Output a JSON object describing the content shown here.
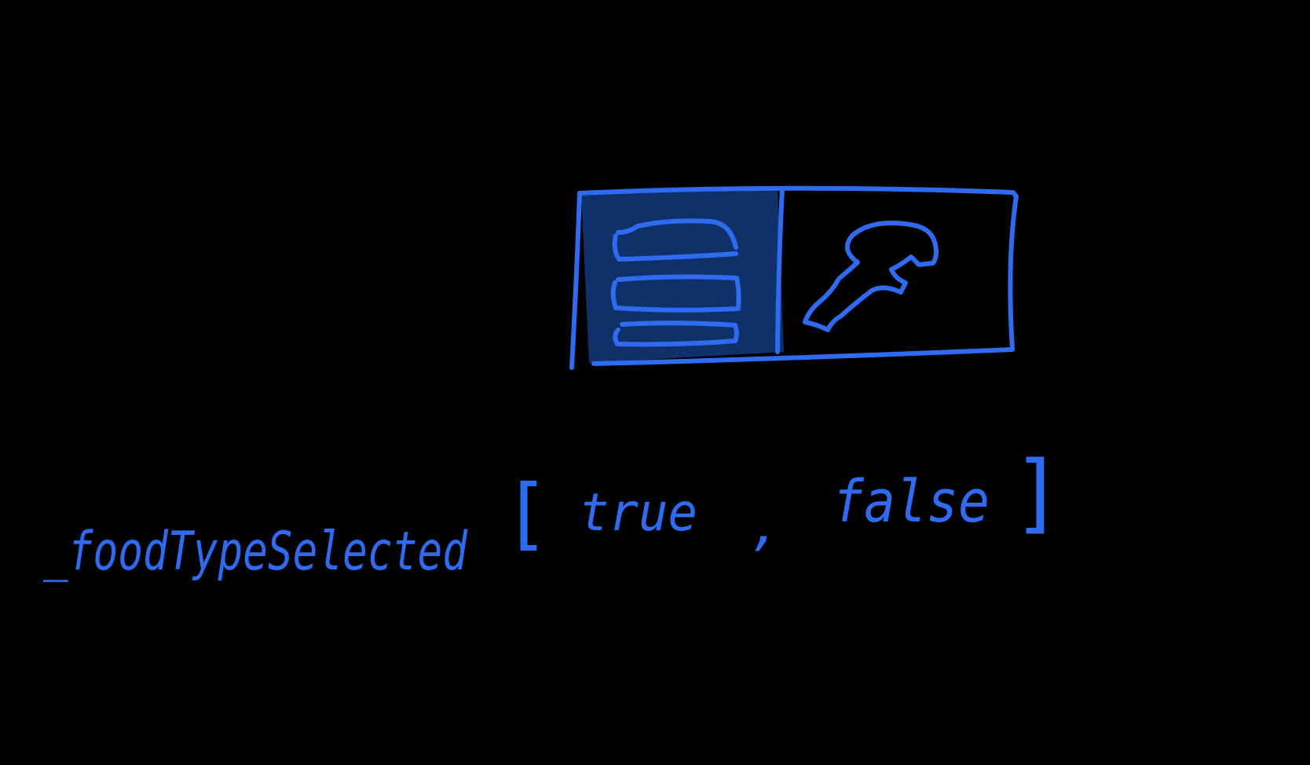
{
  "colors": {
    "background": "#000000",
    "stroke": "#2F6BF0",
    "selected_fill": "#10306A"
  },
  "toggle": {
    "segments": [
      {
        "icon": "burger-icon",
        "selected": true
      },
      {
        "icon": "wrench-icon",
        "selected": false
      }
    ]
  },
  "code": {
    "variable": "_foodTypeSelected",
    "open_bracket": "[",
    "value_1": "true",
    "separator": ",",
    "value_2": "false",
    "close_bracket": "]"
  }
}
